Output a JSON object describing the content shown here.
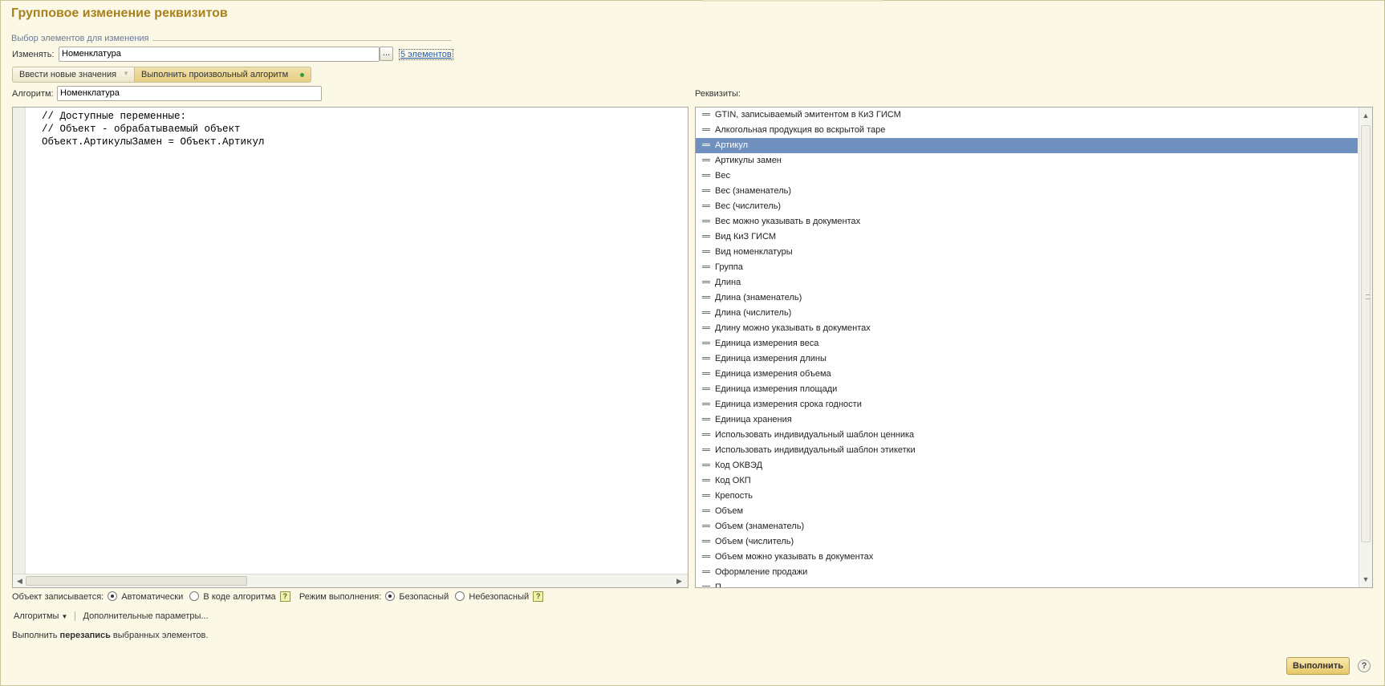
{
  "title": "Групповое изменение реквизитов",
  "selection_group": {
    "caption": "Выбор элементов для изменения",
    "change_label": "Изменять:",
    "change_value": "Номенклатура",
    "dots": "...",
    "elements_link": "5 элементов"
  },
  "tabs": [
    {
      "label": "Ввести новые значения"
    },
    {
      "label": "Выполнить произвольный алгоритм"
    }
  ],
  "algorithm": {
    "label": "Алгоритм:",
    "value": "Номенклатура",
    "code": "// Доступные переменные:\n// Объект - обрабатываемый объект\nОбъект.АртикулыЗамен = Объект.Артикул"
  },
  "requisites": {
    "label": "Реквизиты:",
    "selected": "Артикул",
    "items": [
      "GTIN, записываемый эмитентом в КиЗ ГИСМ",
      "Алкогольная продукция во вскрытой таре",
      "Артикул",
      "Артикулы замен",
      "Вес",
      "Вес (знаменатель)",
      "Вес (числитель)",
      "Вес можно указывать в документах",
      "Вид КиЗ ГИСМ",
      "Вид номенклатуры",
      "Группа",
      "Длина",
      "Длина (знаменатель)",
      "Длина (числитель)",
      "Длину можно указывать в документах",
      "Единица измерения веса",
      "Единица измерения длины",
      "Единица измерения объема",
      "Единица измерения площади",
      "Единица измерения срока годности",
      "Единица хранения",
      "Использовать индивидуальный шаблон ценника",
      "Использовать индивидуальный шаблон этикетки",
      "Код ОКВЭД",
      "Код ОКП",
      "Крепость",
      "Объем",
      "Объем (знаменатель)",
      "Объем (числитель)",
      "Объем можно указывать в документах",
      "Оформление продажи",
      "П..."
    ]
  },
  "options": {
    "write_label": "Объект записывается:",
    "write_auto": "Автоматически",
    "write_code": "В коде алгоритма",
    "mode_label": "Режим выполнения:",
    "mode_safe": "Безопасный",
    "mode_unsafe": "Небезопасный",
    "help": "?"
  },
  "bottom": {
    "algorithms_menu": "Алгоритмы",
    "extra_params": "Дополнительные параметры..."
  },
  "status": {
    "prefix": "Выполнить ",
    "bold": "перезапись",
    "suffix": " выбранных элементов."
  },
  "buttons": {
    "run": "Выполнить",
    "help": "?"
  }
}
